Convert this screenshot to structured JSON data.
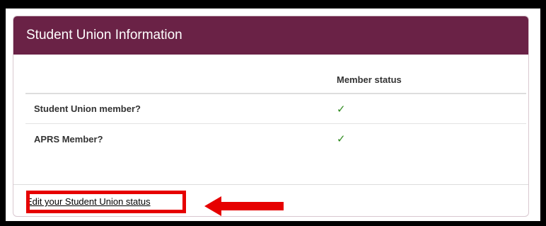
{
  "panel": {
    "title": "Student Union Information",
    "header_color": "#6a2246"
  },
  "table": {
    "column_header": "Member status",
    "rows": [
      {
        "label": "Student Union member?",
        "status": "✓"
      },
      {
        "label": "APRS Member?",
        "status": "✓"
      }
    ]
  },
  "footer": {
    "edit_link_label": "Edit your Student Union status"
  },
  "annotation": {
    "highlight_color": "#e60000",
    "arrow_icon": "arrow-left-icon"
  }
}
